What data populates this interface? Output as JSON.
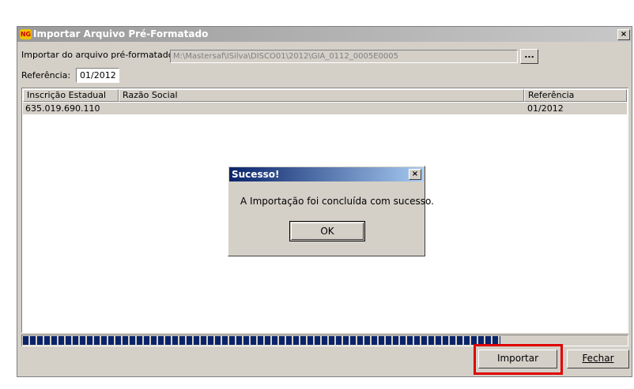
{
  "window": {
    "logo_text": "NG",
    "title": "Importar Arquivo Pré-Formatado",
    "close_glyph": "×"
  },
  "form": {
    "file_label": "Importar do arquivo pré-formatado:",
    "file_path": "M:\\Mastersaf\\ISilva\\DISCO01\\2012\\GIA_0112_0005E0005",
    "browse_label": "...",
    "reference_label": "Referência:",
    "reference_value": "01/2012"
  },
  "grid": {
    "columns": [
      "Inscrição Estadual",
      "Razão Social",
      "Referência"
    ],
    "rows": [
      {
        "inscricao": "635.019.690.110",
        "razao": "",
        "referencia": "01/2012"
      }
    ]
  },
  "progress": {
    "fraction": 0.79,
    "color": "#0a246a"
  },
  "buttons": {
    "import_label": "Importar",
    "close_label": "Fechar",
    "highlight_color": "#e00000"
  },
  "dialog": {
    "title": "Sucesso!",
    "message": "A Importação foi concluída com sucesso.",
    "ok_label": "OK",
    "close_glyph": "×"
  }
}
